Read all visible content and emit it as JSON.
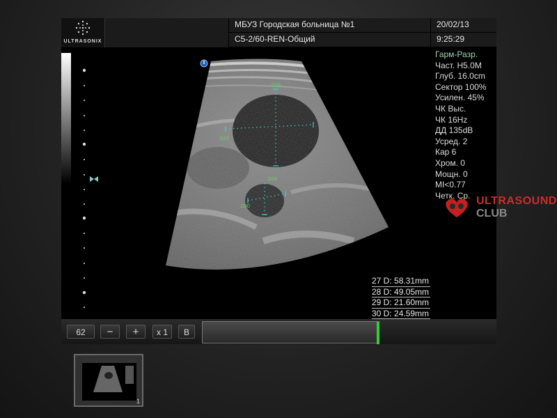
{
  "header": {
    "logo_text": "ULTRASONIX",
    "hospital": "МБУЗ Городская больница №1",
    "preset": "C5-2/60-REN-Общий",
    "date": "20/02/13",
    "time": "9:25:29"
  },
  "params": {
    "mode": "Гарм-Разр.",
    "items": [
      "Част. H5.0M",
      "Глуб. 16.0cm",
      "Сектор 100%",
      "Усилен. 45%",
      "ЧК Выс.",
      "ЧК 16Hz",
      "ДД 135dB",
      "Усред. 2",
      "Кар 6",
      "Хром. 0",
      "Мощн. 0",
      "MI<0.77",
      "Четк. Ср."
    ]
  },
  "calipers": [
    "D28",
    "D27",
    "D29",
    "D30"
  ],
  "measurements": [
    "27 D: 58.31mm",
    "28 D: 49.05mm",
    "29 D: 21.60mm",
    "30 D: 24.59mm"
  ],
  "watermark": {
    "line1": "ULTRASOUND",
    "line2": "CLUB"
  },
  "controls": {
    "value": "62",
    "minus": "−",
    "plus": "+",
    "zoom": "x 1",
    "mode": "B"
  },
  "thumbnail": {
    "number": "1"
  },
  "colors": {
    "param_mode": "#9ed6b0",
    "caliper": "#3ecfcf",
    "cine_marker": "#2fd02f",
    "watermark_red": "#cf2b2b"
  }
}
